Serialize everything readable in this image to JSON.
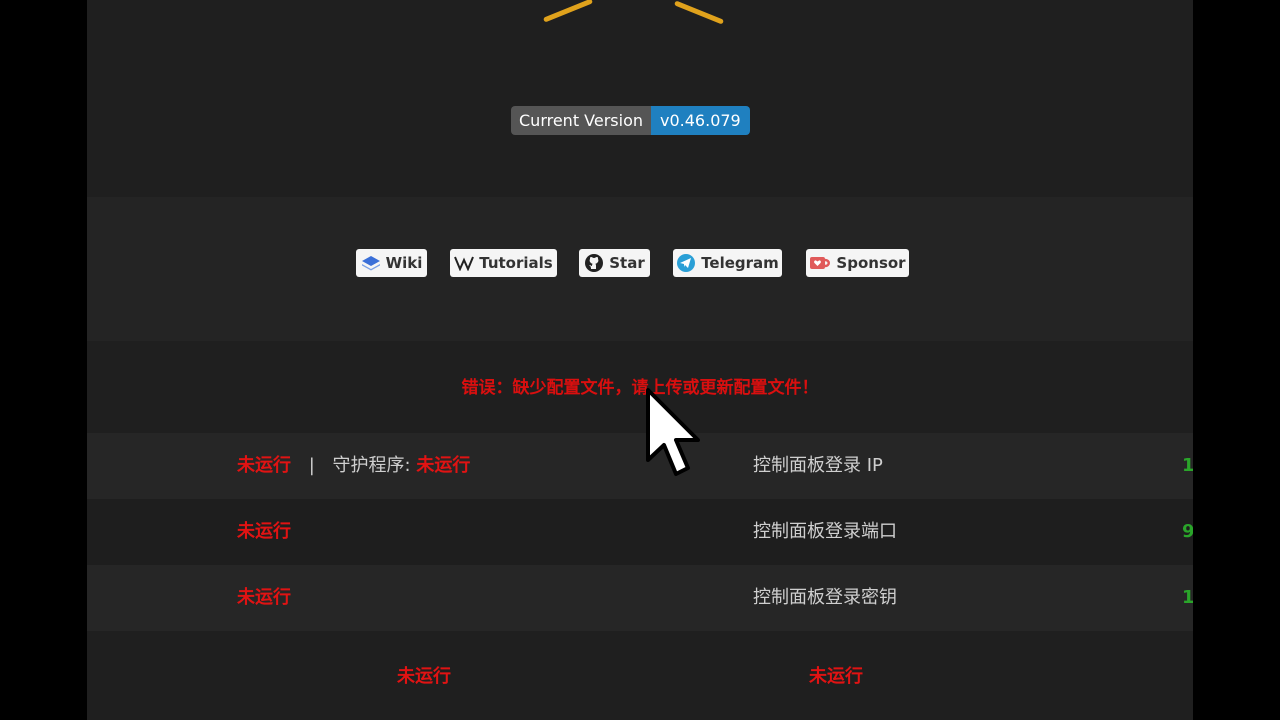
{
  "version": {
    "label": "Current Version",
    "value": "v0.46.079"
  },
  "links": [
    {
      "label": "Wiki",
      "icon": "layers-icon"
    },
    {
      "label": "Tutorials",
      "icon": "wikipedia-icon"
    },
    {
      "label": "Star",
      "icon": "github-icon"
    },
    {
      "label": "Telegram",
      "icon": "telegram-icon"
    },
    {
      "label": "Sponsor",
      "icon": "kofi-cup-icon"
    }
  ],
  "error": "错误：缺少配置文件，请上传或更新配置文件！",
  "status": {
    "row1": {
      "status": "未运行",
      "separator": "|",
      "daemon_label": "守护程序:",
      "daemon_status": "未运行",
      "right_label": "控制面板登录 IP",
      "right_value": "1"
    },
    "row2": {
      "status": "未运行",
      "right_label": "控制面板登录端口",
      "right_value": "9"
    },
    "row3": {
      "status": "未运行",
      "right_label": "控制面板登录密钥",
      "right_value": "1"
    }
  },
  "bottom": {
    "left_status": "未运行",
    "right_status": "未运行"
  },
  "colors": {
    "error_red": "#e11313",
    "value_green": "#2aa52a",
    "badge_blue": "#1f80c0",
    "logo_orange": "#e0a21c"
  }
}
